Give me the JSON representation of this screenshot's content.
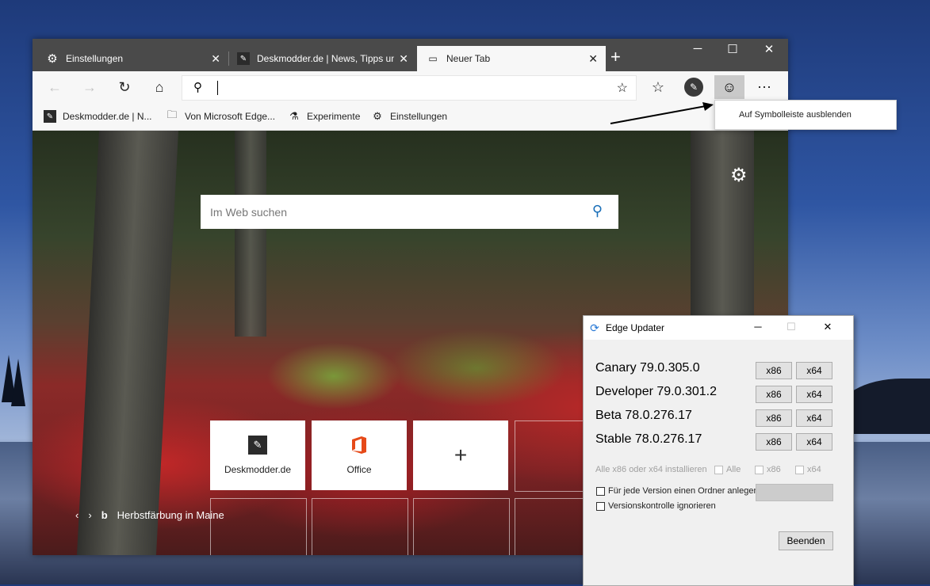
{
  "tabs": [
    {
      "label": "Einstellungen",
      "icon": "gear-icon",
      "active": false
    },
    {
      "label": "Deskmodder.de | News, Tipps un",
      "icon": "deskmodder-icon",
      "active": false
    },
    {
      "label": "Neuer Tab",
      "icon": "newtab-icon",
      "active": true
    }
  ],
  "favorites": [
    {
      "label": "Deskmodder.de | N...",
      "icon": "deskmodder-icon"
    },
    {
      "label": "Von Microsoft Edge...",
      "icon": "folder-icon"
    },
    {
      "label": "Experimente",
      "icon": "flask-icon"
    },
    {
      "label": "Einstellungen",
      "icon": "gear-icon"
    }
  ],
  "tooltip": {
    "text": "Auf Symbolleiste ausblenden"
  },
  "newtab": {
    "search_placeholder": "Im Web suchen",
    "tiles": [
      {
        "label": "Deskmodder.de",
        "icon": "deskmodder-icon"
      },
      {
        "label": "Office",
        "icon": "office-icon"
      },
      {
        "label": "",
        "icon": "plus-icon"
      }
    ],
    "image_credit": "Herbstfärbung in Maine"
  },
  "updater": {
    "title": "Edge Updater",
    "versions": [
      {
        "name": "Canary 79.0.305.0"
      },
      {
        "name": "Developer 79.0.301.2"
      },
      {
        "name": "Beta 78.0.276.17"
      },
      {
        "name": "Stable 78.0.276.17"
      }
    ],
    "btn_x86": "x86",
    "btn_x64": "x64",
    "install_all_label": "Alle x86 oder x64 installieren",
    "chk_all": "Alle",
    "chk_x86": "x86",
    "chk_x64": "x64",
    "folder_option": "Für jede Version einen Ordner anlegen",
    "ignore_option": "Versionskontrolle ignorieren",
    "exit_button": "Beenden"
  },
  "colors": {
    "accent": "#1a6fb8",
    "office": "#e64a19"
  }
}
